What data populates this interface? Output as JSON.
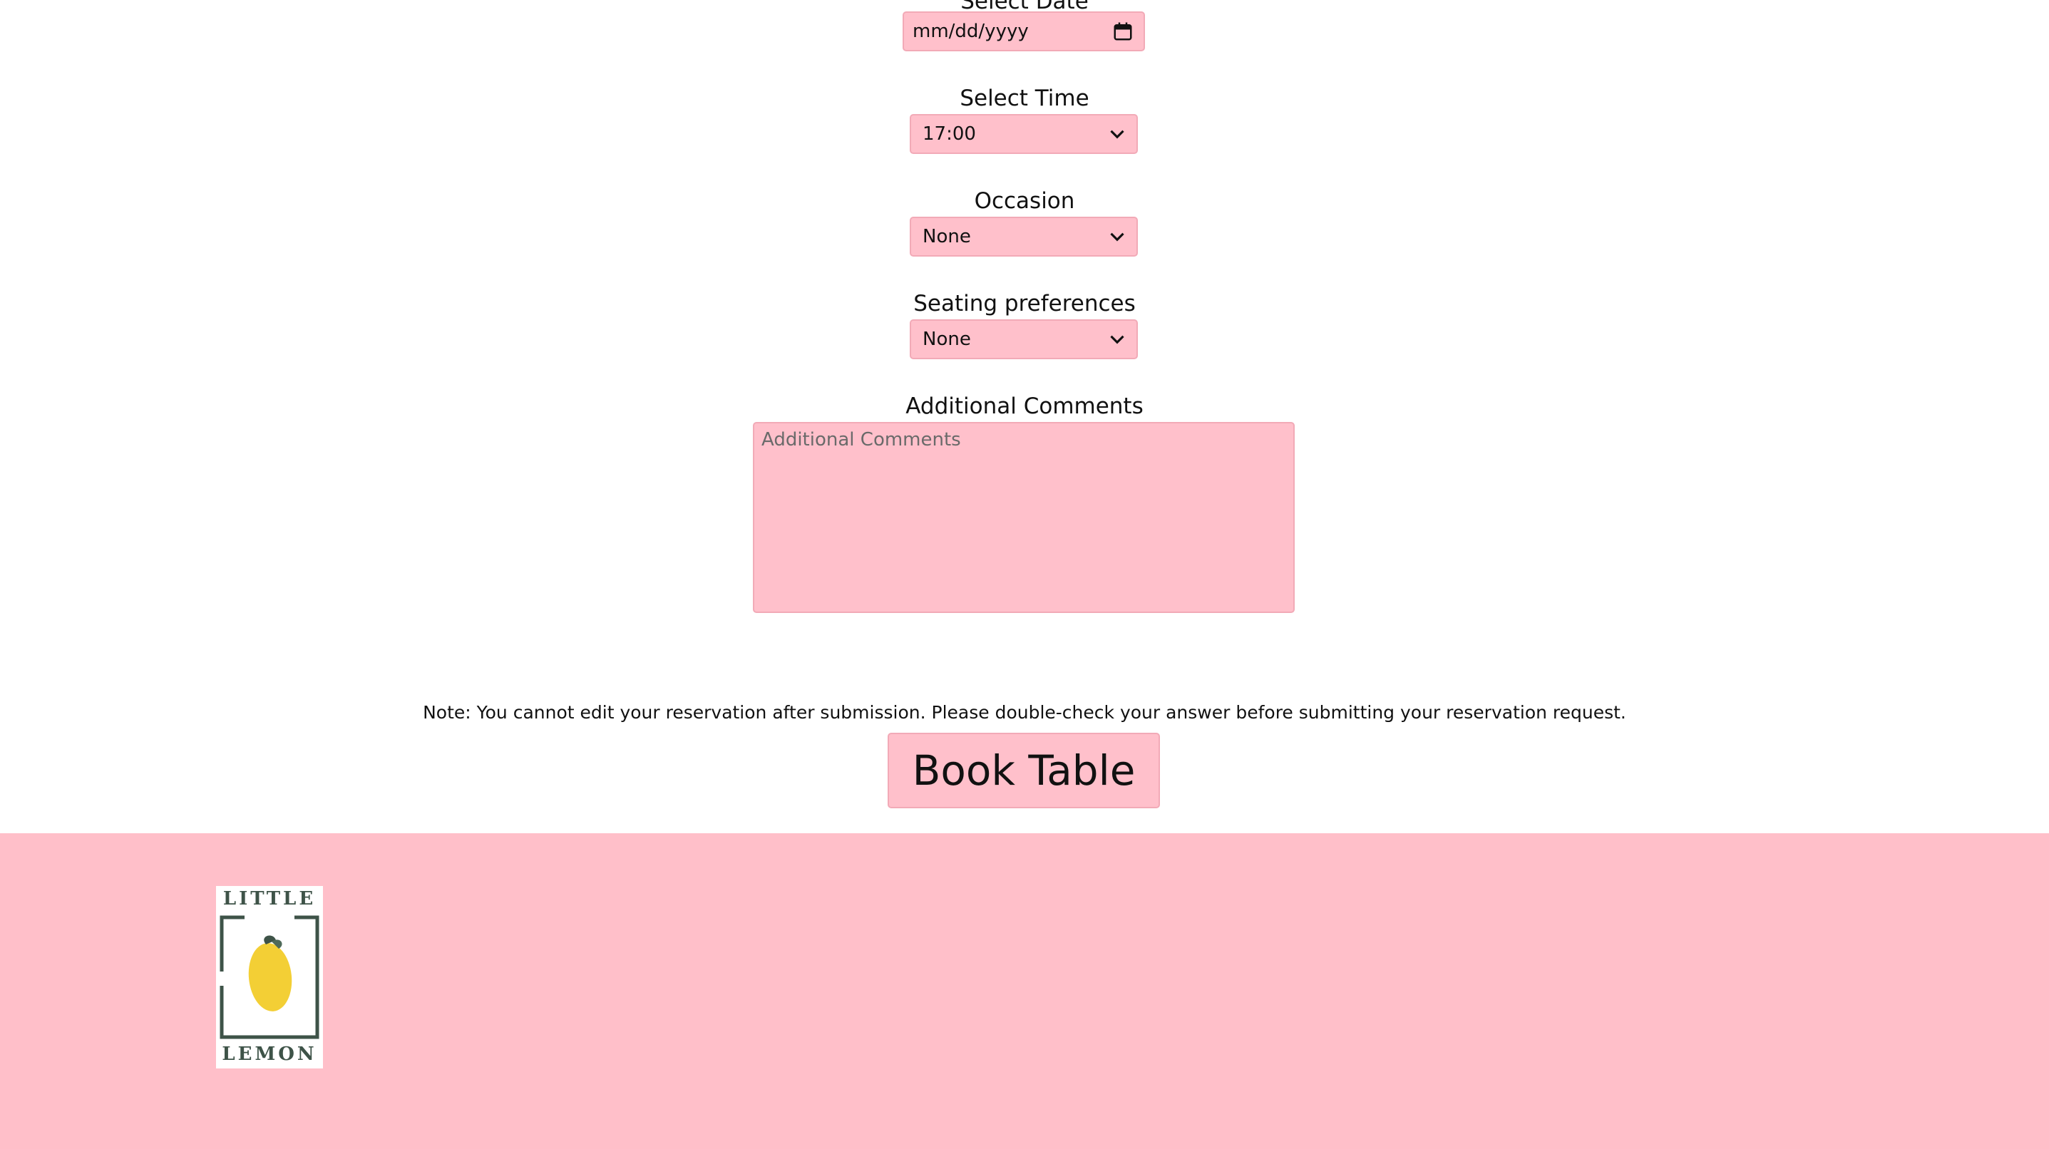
{
  "form": {
    "date_label": "Select Date",
    "date_placeholder": "mm/dd/yyyy",
    "time_label": "Select Time",
    "time_value": "17:00",
    "occasion_label": "Occasion",
    "occasion_value": "None",
    "seating_label": "Seating preferences",
    "seating_value": "None",
    "comments_label": "Additional Comments",
    "comments_placeholder": "Additional Comments",
    "note": "Note: You cannot edit your reservation after submission. Please double-check your answer before submitting your reservation request.",
    "submit_label": "Book Table"
  },
  "footer": {
    "logo_top_text": "LITTLE",
    "logo_bottom_text": "LEMON",
    "background_color": "#ffbfc9"
  },
  "colors": {
    "field_background": "#ffc0cb",
    "page_background": "#ffffff",
    "lemon": "#f3cf35",
    "logo_ink": "#3e5348"
  },
  "icons": {
    "calendar": "calendar-icon",
    "dropdown": "chevron-down-icon",
    "brand": "lemon-icon"
  }
}
